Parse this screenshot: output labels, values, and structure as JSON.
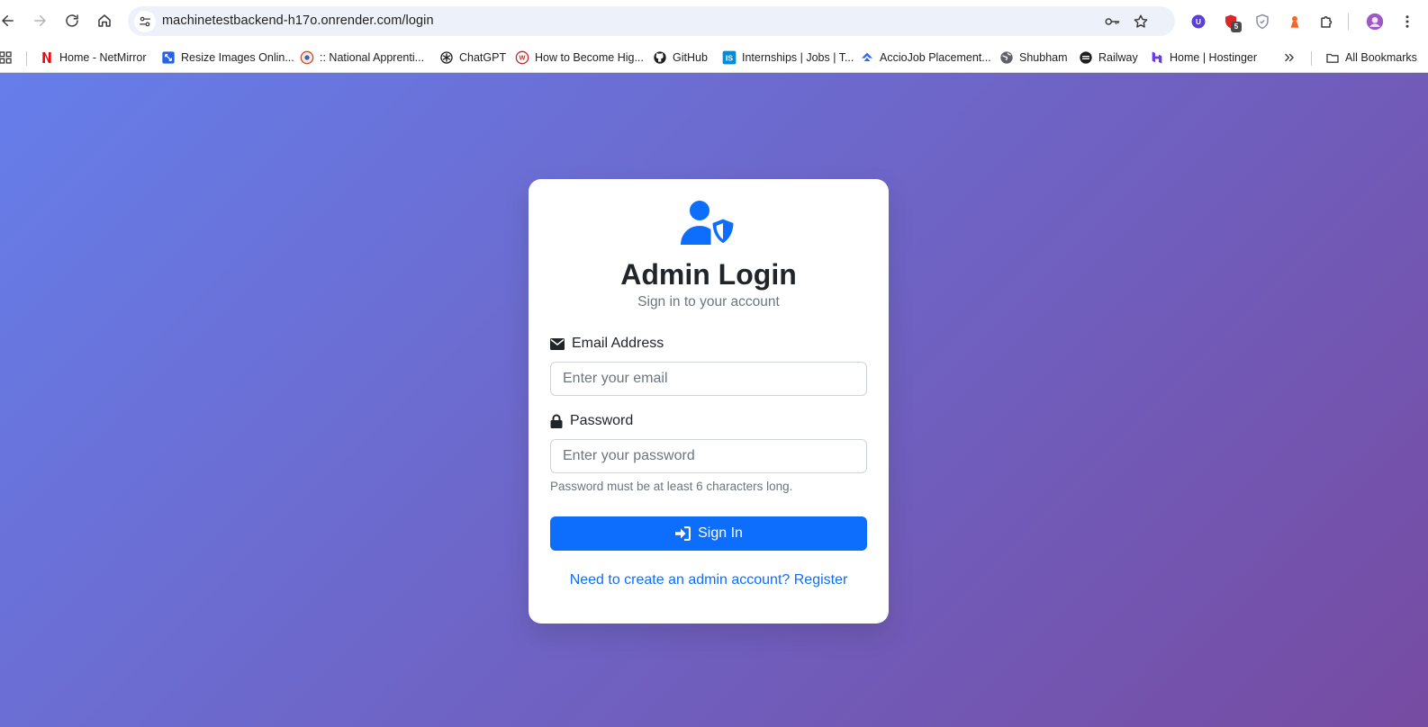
{
  "browser": {
    "url": "machinetestbackend-h17o.onrender.com/login",
    "extension_badge": "5"
  },
  "bookmarks": [
    {
      "label": "Home - NetMirror",
      "icon": "netmirror-icon"
    },
    {
      "label": "Resize Images Onlin...",
      "icon": "resize-images-icon"
    },
    {
      "label": ":: National Apprenti...",
      "icon": "national-apprenticeship-icon"
    },
    {
      "label": "ChatGPT",
      "icon": "chatgpt-icon"
    },
    {
      "label": "How to Become Hig...",
      "icon": "how-to-icon"
    },
    {
      "label": "GitHub",
      "icon": "github-icon"
    },
    {
      "label": "Internships | Jobs | T...",
      "icon": "internshala-icon"
    },
    {
      "label": "AccioJob Placement...",
      "icon": "acciojob-icon"
    },
    {
      "label": "Shubham",
      "icon": "globe-icon"
    },
    {
      "label": "Railway",
      "icon": "railway-icon"
    },
    {
      "label": "Home | Hostinger",
      "icon": "hostinger-icon"
    }
  ],
  "all_bookmarks_label": "All Bookmarks",
  "login": {
    "title": "Admin Login",
    "subtitle": "Sign in to your account",
    "email_label": "Email Address",
    "email_placeholder": "Enter your email",
    "password_label": "Password",
    "password_placeholder": "Enter your password",
    "password_hint": "Password must be at least 6 characters long.",
    "submit_label": "Sign In",
    "register_link": "Need to create an admin account? Register"
  },
  "colors": {
    "gradient_start": "#667eea",
    "gradient_end": "#764ba2",
    "primary": "#0d6efd",
    "card_bg": "#ffffff"
  }
}
